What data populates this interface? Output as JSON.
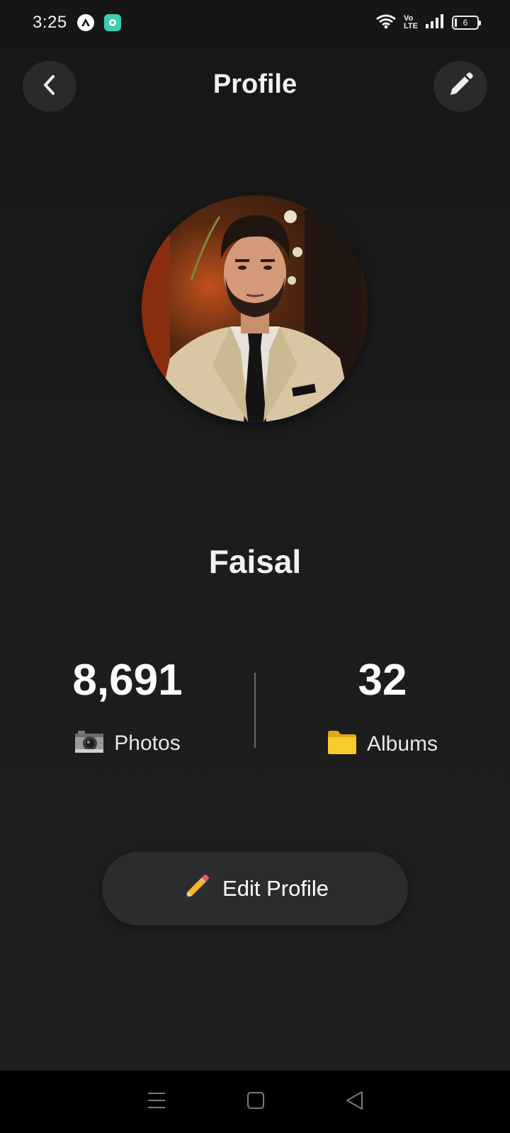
{
  "status_bar": {
    "time": "3:25",
    "battery_level": "6",
    "network_label_top": "Vo",
    "network_label_bottom": "LTE"
  },
  "header": {
    "title": "Profile",
    "back_icon": "chevron-left-icon",
    "edit_icon": "pencil-icon"
  },
  "profile": {
    "name": "Faisal",
    "avatar": "profile-photo"
  },
  "stats": {
    "photos": {
      "value": "8,691",
      "label": "Photos",
      "icon": "camera-icon"
    },
    "albums": {
      "value": "32",
      "label": "Albums",
      "icon": "folder-icon"
    }
  },
  "actions": {
    "edit_profile_label": "Edit Profile",
    "edit_profile_icon": "pencil-emoji-icon"
  },
  "colors": {
    "background": "#1c1c1c",
    "button_bg": "#2c2c2e",
    "text": "#ffffff",
    "divider": "#6a6a6a"
  }
}
